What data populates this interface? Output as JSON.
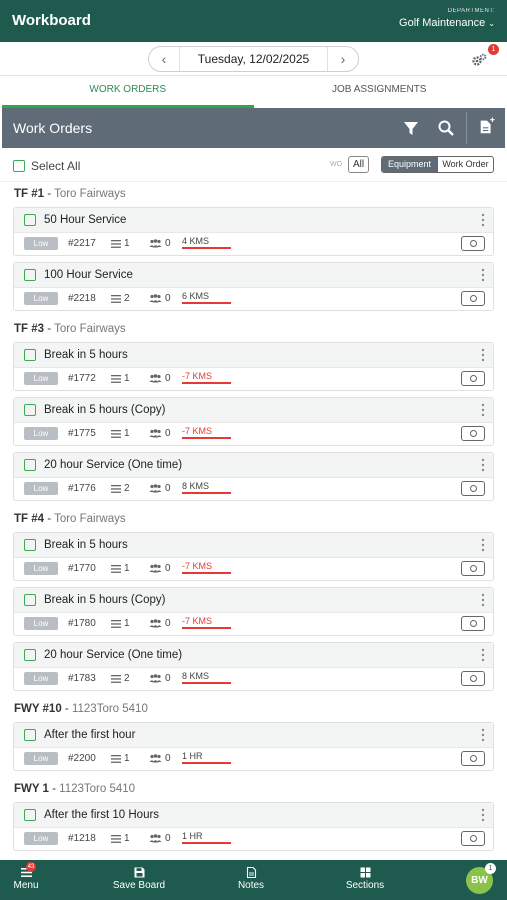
{
  "header": {
    "title": "Workboard",
    "department_label": "DEPARTMENT:",
    "department_value": "Golf Maintenance"
  },
  "datebar": {
    "date": "Tuesday, 12/02/2025",
    "settings_badge": "1"
  },
  "tabs": [
    {
      "label": "WORK ORDERS",
      "active": true
    },
    {
      "label": "JOB ASSIGNMENTS",
      "active": false
    }
  ],
  "toolbar": {
    "title": "Work Orders"
  },
  "filters": {
    "select_all": "Select All",
    "wo_label": "WO",
    "all_label": "All",
    "equipment_label": "Equipment",
    "workorder_label": "Work Order"
  },
  "groups": [
    {
      "name": "TF #1",
      "sub": "Toro Fairways",
      "items": [
        {
          "title": "50 Hour Service",
          "priority": "Low",
          "number": "#2217",
          "tasks": "1",
          "people": "0",
          "meter": "4 KMS",
          "neg": false
        },
        {
          "title": "100 Hour Service",
          "priority": "Low",
          "number": "#2218",
          "tasks": "2",
          "people": "0",
          "meter": "6 KMS",
          "neg": false
        }
      ]
    },
    {
      "name": "TF #3",
      "sub": "Toro Fairways",
      "items": [
        {
          "title": "Break in 5 hours",
          "priority": "Low",
          "number": "#1772",
          "tasks": "1",
          "people": "0",
          "meter": "-7 KMS",
          "neg": true
        },
        {
          "title": "Break in 5 hours (Copy)",
          "priority": "Low",
          "number": "#1775",
          "tasks": "1",
          "people": "0",
          "meter": "-7 KMS",
          "neg": true
        },
        {
          "title": "20 hour Service (One time)",
          "priority": "Low",
          "number": "#1776",
          "tasks": "2",
          "people": "0",
          "meter": "8 KMS",
          "neg": false
        }
      ]
    },
    {
      "name": "TF #4",
      "sub": "Toro Fairways",
      "items": [
        {
          "title": "Break in 5 hours",
          "priority": "Low",
          "number": "#1770",
          "tasks": "1",
          "people": "0",
          "meter": "-7 KMS",
          "neg": true
        },
        {
          "title": "Break in 5 hours (Copy)",
          "priority": "Low",
          "number": "#1780",
          "tasks": "1",
          "people": "0",
          "meter": "-7 KMS",
          "neg": true
        },
        {
          "title": "20 hour Service (One time)",
          "priority": "Low",
          "number": "#1783",
          "tasks": "2",
          "people": "0",
          "meter": "8 KMS",
          "neg": false
        }
      ]
    },
    {
      "name": "FWY #10",
      "sub": "1123Toro 5410",
      "items": [
        {
          "title": "After the first hour",
          "priority": "Low",
          "number": "#2200",
          "tasks": "1",
          "people": "0",
          "meter": "1 HR",
          "neg": false
        }
      ]
    },
    {
      "name": "FWY 1",
      "sub": "1123Toro 5410",
      "items": [
        {
          "title": "After the first 10 Hours",
          "priority": "Low",
          "number": "#1218",
          "tasks": "1",
          "people": "0",
          "meter": "1 HR",
          "neg": false
        }
      ]
    }
  ],
  "bottom_nav": {
    "menu": "Menu",
    "menu_badge": "43",
    "save_board": "Save Board",
    "notes": "Notes",
    "sections": "Sections",
    "avatar": "BW",
    "avatar_badge": "1"
  },
  "colors": {
    "brand": "#1e5b4e",
    "accent": "#2ea84a",
    "toolbar": "#5f6c78",
    "negative": "#e53935"
  }
}
